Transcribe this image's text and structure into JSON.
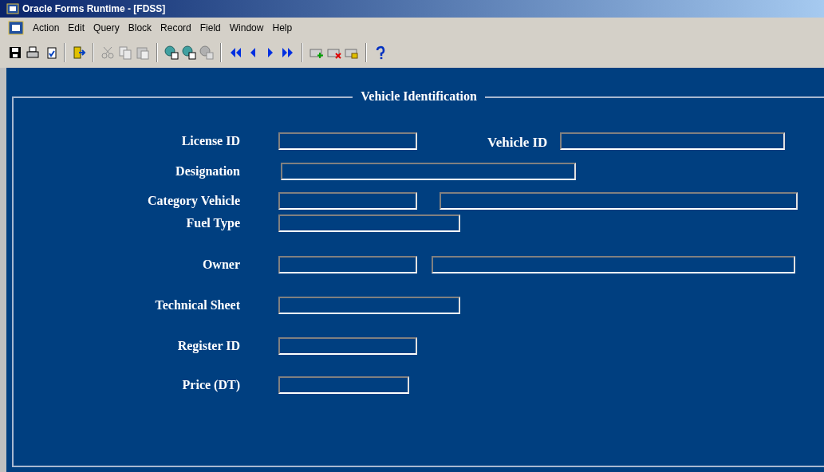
{
  "window": {
    "title": "Oracle Forms Runtime - [FDSS]"
  },
  "menu": [
    "Action",
    "Edit",
    "Query",
    "Block",
    "Record",
    "Field",
    "Window",
    "Help"
  ],
  "form": {
    "title": "Vehicle Identification",
    "rows": [
      {
        "label": "License ID",
        "fields": [
          {
            "kind": "input"
          },
          {
            "kind": "labeled_input",
            "label": "Vehicle ID"
          }
        ]
      },
      {
        "label": "Designation",
        "fields": [
          {
            "kind": "input"
          }
        ]
      },
      {
        "label": "Category Vehicle",
        "fields": [
          {
            "kind": "input"
          },
          {
            "kind": "input"
          }
        ]
      },
      {
        "label": "Fuel Type",
        "fields": [
          {
            "kind": "input"
          }
        ]
      },
      {
        "label": "Owner",
        "fields": [
          {
            "kind": "input"
          },
          {
            "kind": "input"
          }
        ]
      },
      {
        "label": "Technical Sheet",
        "fields": [
          {
            "kind": "input"
          }
        ]
      },
      {
        "label": "Register ID",
        "fields": [
          {
            "kind": "input"
          }
        ]
      },
      {
        "label": "Price (DT)",
        "fields": [
          {
            "kind": "input"
          }
        ]
      }
    ]
  }
}
